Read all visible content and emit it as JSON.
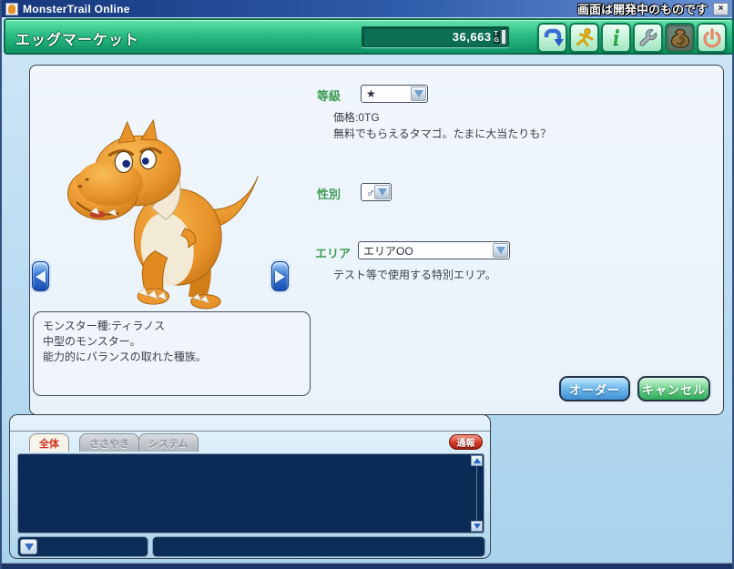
{
  "window": {
    "title": "MonsterTrail Online",
    "dev_notice": "画面は開発中のものです",
    "close": "×"
  },
  "header": {
    "title": "エッグマーケット",
    "money_value": "36,663",
    "currency_top": "T",
    "currency_bottom": "G"
  },
  "toolbar": {
    "info_glyph": "i",
    "items": [
      "return",
      "run",
      "info",
      "settings",
      "market",
      "power"
    ],
    "pressed_item": "market"
  },
  "form": {
    "grade_label": "等級",
    "grade_value": "★",
    "price_text": "価格:0TG",
    "grade_description": "無料でもらえるタマゴ。たまに大当たりも？",
    "gender_label": "性別",
    "gender_value": "♂",
    "area_label": "エリア",
    "area_value": "エリアOO",
    "area_description": "テスト等で使用する特別エリア。"
  },
  "monster": {
    "species": "ティラノス",
    "description_lines": [
      "モンスター種:ティラノス",
      "中型のモンスター。",
      "能力的にバランスの取れた種族。"
    ]
  },
  "actions": {
    "order": "オーダー",
    "cancel": "キャンセル"
  },
  "chat": {
    "tabs": [
      {
        "label": "全体",
        "active": true
      },
      {
        "label": "ささやき",
        "active": false
      },
      {
        "label": "システム",
        "active": false
      }
    ],
    "report": "通報",
    "log_text": "",
    "input_value": ""
  },
  "colors": {
    "header_green": "#1ca76e",
    "accent_blue": "#2a6ad0",
    "chat_bg": "#0b2a55",
    "tab_active_text": "#d2311e",
    "monster_orange": "#e88f28"
  }
}
